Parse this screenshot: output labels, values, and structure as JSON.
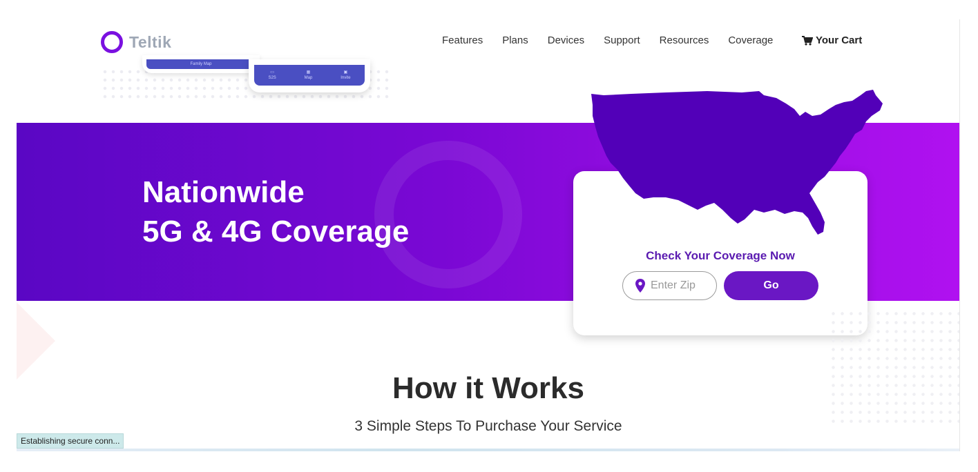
{
  "header": {
    "logo_text": "Teltik",
    "nav": [
      "Features",
      "Plans",
      "Devices",
      "Support",
      "Resources",
      "Coverage"
    ],
    "cart_label": "Your Cart"
  },
  "phone": {
    "bar1_label": "Family Map",
    "tabs": [
      "S2S",
      "Map",
      "Invite"
    ]
  },
  "hero": {
    "title_line1": "Nationwide",
    "title_line2": "5G & 4G Coverage"
  },
  "coverage": {
    "title": "Check Your Coverage Now",
    "zip_placeholder": "Enter Zip",
    "go_label": "Go"
  },
  "how": {
    "title": "How it Works",
    "subtitle": "3 Simple Steps To Purchase Your Service"
  },
  "status_text": "Establishing secure conn...",
  "colors": {
    "brand_purple": "#7a10e0",
    "map_purple": "#5200b8",
    "button_purple": "#6a17c4",
    "card_title": "#5a1ab0"
  }
}
